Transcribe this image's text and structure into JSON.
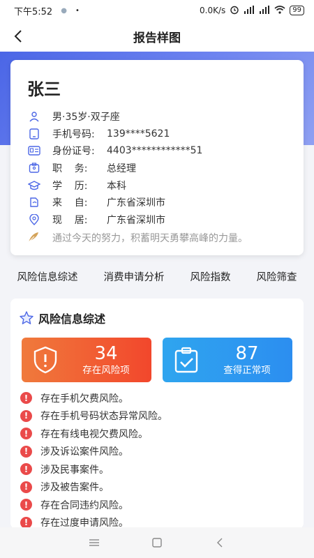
{
  "status": {
    "time": "下午5:52",
    "speed": "0.0K/s",
    "battery": "99"
  },
  "nav": {
    "title": "报告样图"
  },
  "profile": {
    "name": "张三",
    "rows": [
      {
        "icon": "user-icon",
        "label": "",
        "value": "男·35岁·双子座"
      },
      {
        "icon": "phone-icon",
        "label": "手机号码:",
        "value": "139****5621"
      },
      {
        "icon": "id-card-icon",
        "label": "身份证号:",
        "value": "4403************51"
      },
      {
        "icon": "badge-icon",
        "label": "职    务:",
        "value": "总经理"
      },
      {
        "icon": "education-icon",
        "label": "学    历:",
        "value": "本科"
      },
      {
        "icon": "origin-icon",
        "label": "来    自:",
        "value": "广东省深圳市"
      },
      {
        "icon": "location-icon",
        "label": "现    居:",
        "value": "广东省深圳市"
      }
    ],
    "slogan": "通过今天的努力，积蓄明天勇攀高峰的力量。"
  },
  "tabs": [
    "风险信息综述",
    "消费申请分析",
    "风险指数",
    "风险筛查"
  ],
  "summary": {
    "title": "风险信息综述",
    "risk_count": "34",
    "risk_label": "存在风险项",
    "ok_count": "87",
    "ok_label": "查得正常项",
    "items": [
      "存在手机欠费风险。",
      "存在手机号码状态异常风险。",
      "存在有线电视欠费风险。",
      "涉及诉讼案件风险。",
      "涉及民事案件。",
      "涉及被告案件。",
      "存在合同违约风险。",
      "存在过度申请风险。"
    ]
  },
  "colors": {
    "accent": "#4b66e6",
    "risk": "#f2472c",
    "ok": "#2c8ef0",
    "alert_dot": "#ea4a4a"
  }
}
